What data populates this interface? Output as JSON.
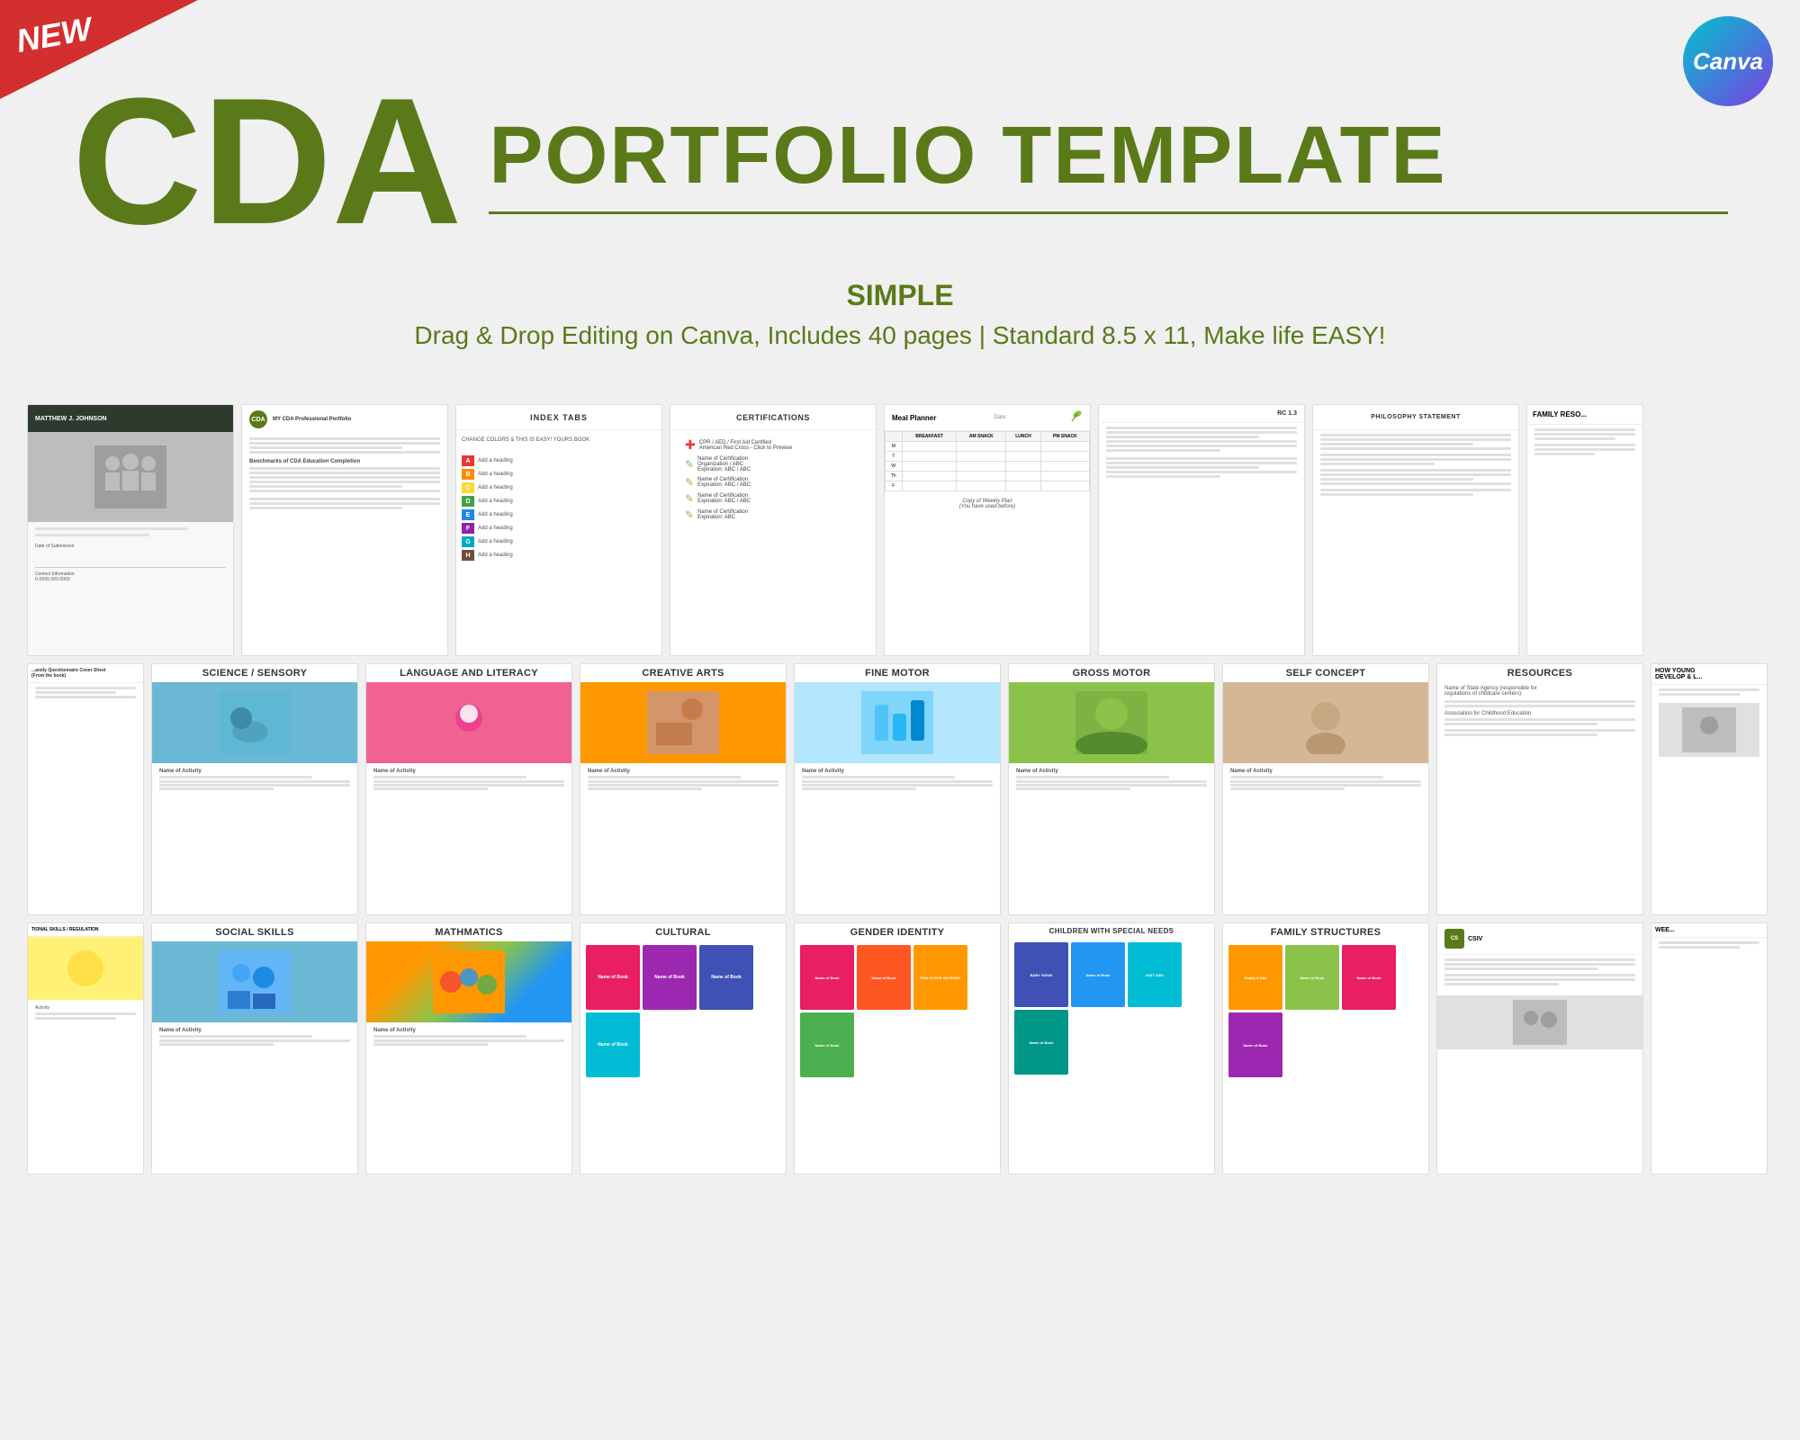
{
  "banner": {
    "new_label": "NEW"
  },
  "canva": {
    "logo_text": "Canva"
  },
  "header": {
    "cda": "CDA",
    "portfolio_template": "PORTFOLIO TEMPLATE",
    "simple": "SIMPLE",
    "description": "Drag & Drop Editing on Canva, Includes 40 pages | Standard 8.5 x 11, Make life EASY!"
  },
  "row1": {
    "cards": [
      {
        "id": "cover",
        "title": "MATTHEW J. JOHNSON",
        "type": "cover"
      },
      {
        "id": "summary",
        "title": "MY CDA Professional Portfolio",
        "type": "text"
      },
      {
        "id": "index",
        "title": "INDEX TABS",
        "type": "index"
      },
      {
        "id": "certifications",
        "title": "CERTIFICATIONS",
        "type": "cert"
      },
      {
        "id": "meal",
        "title": "Meal Planner",
        "type": "meal"
      },
      {
        "id": "rc",
        "title": "RC 1.3",
        "type": "rc"
      },
      {
        "id": "philosophy",
        "title": "PHILOSOPHY STATEMENT",
        "type": "text"
      },
      {
        "id": "family-res",
        "title": "FAMILY RESO...",
        "type": "text"
      }
    ]
  },
  "row2": {
    "cards": [
      {
        "id": "sci-sensory",
        "title": "SCIENCE / SENSORY",
        "type": "activity",
        "color": "photo-blue"
      },
      {
        "id": "lang-lit",
        "title": "LANGUAGE AND LITERACY",
        "type": "activity",
        "color": "photo-pink"
      },
      {
        "id": "creative-arts",
        "title": "CREATIVE ARTS",
        "type": "activity",
        "color": "photo-orange"
      },
      {
        "id": "fine-motor",
        "title": "FINE MOTOR",
        "type": "activity",
        "color": "photo-light-blue"
      },
      {
        "id": "gross-motor",
        "title": "GROSS MOTOR",
        "type": "activity",
        "color": "photo-green"
      },
      {
        "id": "self-concept",
        "title": "SELF CONCEPT",
        "type": "activity",
        "color": "photo-tan"
      },
      {
        "id": "resources",
        "title": "RESOURCES",
        "type": "resources"
      },
      {
        "id": "how-young",
        "title": "HOW YOUNG DEVELOP & L...",
        "type": "partial"
      }
    ]
  },
  "row3": {
    "cards": [
      {
        "id": "tional-skills",
        "title": "TIONAL SKILLS / REGULATION",
        "type": "activity-partial",
        "color": "photo-yellow"
      },
      {
        "id": "social-skills",
        "title": "SOCIAL SKILLS",
        "type": "activity",
        "color": "photo-blue"
      },
      {
        "id": "mathmatics",
        "title": "MATHMATICS",
        "type": "activity",
        "color": "photo-multi"
      },
      {
        "id": "cultural",
        "title": "CULTURAL",
        "type": "books"
      },
      {
        "id": "gender-identity",
        "title": "GENDER IDENTITY",
        "type": "books"
      },
      {
        "id": "children-special",
        "title": "CHILDREN WITH SPECIAL NEEDS",
        "type": "books"
      },
      {
        "id": "family-structures",
        "title": "FAMILY STRUCTURES",
        "type": "books"
      },
      {
        "id": "csiv",
        "title": "CSIV",
        "type": "csiv"
      },
      {
        "id": "wee",
        "title": "WEE...",
        "type": "partial-right"
      }
    ]
  },
  "index_tabs": {
    "items": [
      {
        "letter": "A",
        "color": "#e53935",
        "label": "Add a heading"
      },
      {
        "letter": "B",
        "color": "#fb8c00",
        "label": "Add a heading"
      },
      {
        "letter": "C",
        "color": "#fdd835",
        "label": "Add a heading"
      },
      {
        "letter": "D",
        "color": "#43a047",
        "label": "Add a heading"
      },
      {
        "letter": "E",
        "color": "#1e88e5",
        "label": "Add a heading"
      },
      {
        "letter": "F",
        "color": "#8e24aa",
        "label": "Add a heading"
      },
      {
        "letter": "G",
        "color": "#00acc1",
        "label": "Add a heading"
      },
      {
        "letter": "H",
        "color": "#6d4c41",
        "label": "Add a heading"
      }
    ]
  }
}
